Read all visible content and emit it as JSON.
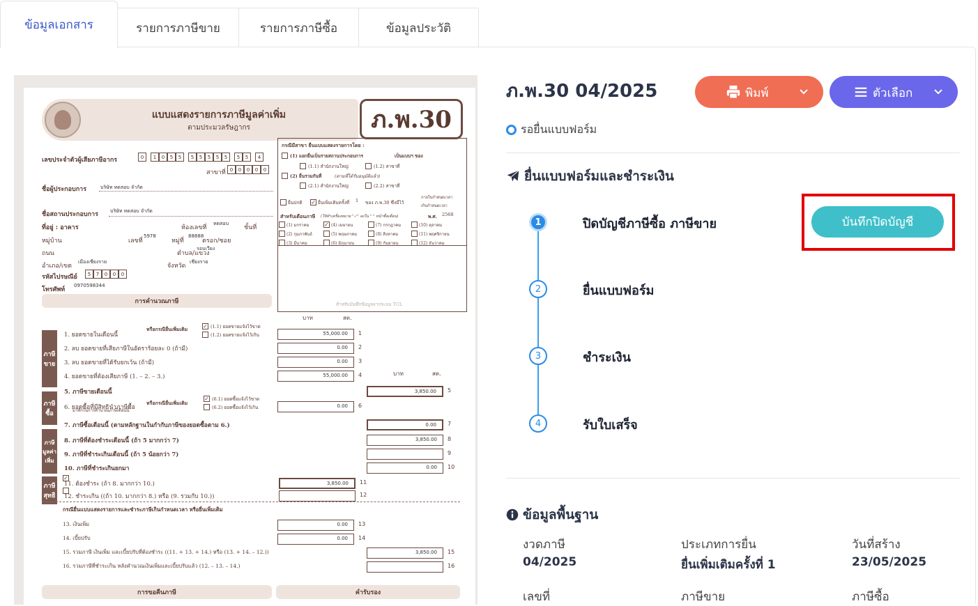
{
  "tabs": [
    {
      "label": "ข้อมูลเอกสาร",
      "active": true
    },
    {
      "label": "รายการภาษีขาย",
      "active": false
    },
    {
      "label": "รายการภาษีซื้อ",
      "active": false
    },
    {
      "label": "ข้อมูลประวัติ",
      "active": false
    }
  ],
  "doc": {
    "title": "แบบแสดงรายการภาษีมูลค่าเพิ่ม",
    "subtitle": "ตามประมวลรัษฎากร",
    "form_code": "ภ.พ.30",
    "taxid_label": "เลขประจำตัวผู้เสียภาษีอากร",
    "taxid_digits": [
      "0",
      "1",
      "0",
      "5",
      "5",
      "5",
      "5",
      "5",
      "5",
      "5",
      "5",
      "5",
      "4"
    ],
    "branch_label": "สาขาที่",
    "branch_digits": [
      "0",
      "0",
      "0",
      "0",
      "0"
    ],
    "operator_label": "ชื่อผู้ประกอบการ",
    "operator_value": "บริษัท ทดสอบ จำกัด",
    "place_label": "ชื่อสถานประกอบการ",
    "place_value": "บริษัท ทดสอบ จำกัด",
    "address_label": "ที่อยู่ : อาคาร",
    "room_label": "ห้องเลขที่",
    "room_value": "ทดสอบ",
    "floor_label": "ชั้นที่",
    "village_label": "หมู่บ้าน",
    "no_label": "เลขที่",
    "no_value": "5978",
    "moo_label": "หมู่ที่",
    "moo_value": "88888",
    "alley_label": "ตรอก/ซอย",
    "road_label": "ถนน",
    "subdistrict_label": "ตำบล/แขวง",
    "subdistrict_value": "รอบเวียง",
    "district_label": "อำเภอ/เขต",
    "district_value": "เมืองเชียงราย",
    "province_label": "จังหวัด",
    "province_value": "เชียงราย",
    "postcode_label": "รหัสไปรษณีย์",
    "postcode_digits": [
      "5",
      "7",
      "0",
      "0",
      "0"
    ],
    "phone_label": "โทรศัพท์",
    "phone_value": "0970598344",
    "calc_bar": "การคำนวณภาษี",
    "branch_case": "กรณีมีสาขา ยื่นแบบแสดงรายการโดย :",
    "opt1": "(1) แยกยื่นเป็นรายสถานประกอบการ",
    "opt1b": "เป็นแบบฯ ของ",
    "opt11": "(1.1) สำนักงานใหญ่",
    "opt12": "(1.2) สาขาที่",
    "opt2": "(2) ยื่นรวมกันที่",
    "opt2note": "(ตามที่ได้รับอนุมัติแล้ว)",
    "opt21": "(2.1) สำนักงานใหญ่",
    "opt22": "(2.2) สาขาที่",
    "normal": "ยื่นปกติ",
    "additional": "ยื่นเพิ่มเติมครั้งที่",
    "additional_no": "1",
    "of_form": "ของ ภ.พ.30 ซึ่งมีไว้",
    "within": "ภายในกำหนดเวลา",
    "beyond": "เกินกำหนดเวลา",
    "month_label": "สำหรับเดือนภาษี",
    "month_note": "(ให้ทำเครื่องหมาย \"✓\" ลงใน \" \" หน้าชื่อเดือน)",
    "year_label": "พ.ศ.",
    "year_value": "2568",
    "months": [
      "(1) มกราคม",
      "(2) กุมภาพันธ์",
      "(3) มีนาคม",
      "(4) เมษายน",
      "(5) พฤษภาคม",
      "(6) มิถุนายน",
      "(7) กรกฎาคม",
      "(8) สิงหาคม",
      "(9) กันยายน",
      "(10) ตุลาคม",
      "(11) พฤศจิกายน",
      "(12) ธันวาคม"
    ],
    "record_note": "สำหรับบันทึกข้อมูลจากระบบ TCL",
    "col_baht": "บาท",
    "col_satang": "สต.",
    "rows": [
      {
        "label": "1. ยอดขายในเดือนนี้",
        "value": "55,000.00",
        "n": "1"
      },
      {
        "label": "2. ลบ ยอดขายที่เสียภาษีในอัตราร้อยละ 0 (ถ้ามี)",
        "value": "0.00",
        "n": "2"
      },
      {
        "label": "3. ลบ ยอดขายที่ได้รับยกเว้น (ถ้ามี)",
        "value": "0.00",
        "n": "3"
      },
      {
        "label": "4. ยอดขายที่ต้องเสียภาษี (1. – 2. – 3.)",
        "value": "55,000.00",
        "n": "4"
      },
      {
        "label": "5. ภาษีขายเดือนนี้",
        "value": "3,850.00",
        "n": "5"
      },
      {
        "label": "6. ยอดซื้อที่มีสิทธินำภาษีซื้อ",
        "value": "0.00",
        "n": "6"
      },
      {
        "label": "7. ภาษีซื้อเดือนนี้ (ตามหลักฐานในกำกับภาษีของยอดซื้อตาม 6.)",
        "value": "0.00",
        "n": "7"
      },
      {
        "label": "8. ภาษีที่ต้องชำระเดือนนี้ (ถ้า 5 มากกว่า 7)",
        "value": "3,850.00",
        "n": "8"
      },
      {
        "label": "9. ภาษีที่ชำระเกินเดือนนี้ (ถ้า 5 น้อยกว่า 7)",
        "value": "",
        "n": "9"
      },
      {
        "label": "10. ภาษีที่ชำระเกินยกมา",
        "value": "0.00",
        "n": "10"
      },
      {
        "label": "11. ต้องชำระ (ถ้า 8. มากกว่า 10.)",
        "value": "3,850.00",
        "n": "11"
      },
      {
        "label": "12. ชำระเกิน ((ถ้า 10. มากกว่า 8.) หรือ (9. รวมกับ 10.))",
        "value": "",
        "n": "12"
      },
      {
        "label": "13. เงินเพิ่ม",
        "value": "0.00",
        "n": "13"
      },
      {
        "label": "14. เบี้ยปรับ",
        "value": "0.00",
        "n": "14"
      },
      {
        "label": "15. รวมภาษี เงินเพิ่ม และเบี้ยปรับที่ต้องชำระ ((11. + 13. + 14.) หรือ (13. + 14. – 12.))",
        "value": "3,850.00",
        "n": "15"
      },
      {
        "label": "16. รวมภาษีที่ชำระเกิน หลังคำนวณเงินเพิ่มและเบี้ยปรับแล้ว (12. – 13. – 14.)",
        "value": "",
        "n": "16"
      }
    ],
    "or_case_1": "หรือกรณียื่นเพิ่มเติม",
    "sub11": "(1.1) ยอดขายแจ้งไว้ขาด",
    "sub12": "(1.2) ยอดขายแจ้งไว้เกิน",
    "sub61": "(6.1) ยอดซื้อแจ้งไว้ขาด",
    "sub62": "(6.2) ยอดซื้อแจ้งไว้เกิน",
    "note6": "มาหักในการคำนวณภาษีเดือนนี้",
    "late_case": "กรณียื่นแบบแสดงรายการและชำระภาษีเกินกำหนดเวลา หรือยื่นเพิ่มเติม",
    "side_sales": "ภาษีขาย",
    "side_purchase": "ภาษีซื้อ",
    "side_vat": "ภาษีมูลค่าเพิ่ม",
    "side_net": "ภาษีสุทธิ",
    "refund_bar": "การขอคืนภาษี",
    "certify_bar": "คำรับรอง"
  },
  "right": {
    "title": "ภ.พ.30 04/2025",
    "print_label": "พิมพ์",
    "options_label": "ตัวเลือก",
    "status_text": "รอยื่นแบบฟอร์ม",
    "status_color": "#2b8be6",
    "section_submit": "ยื่นแบบฟอร์มและชำระเงิน",
    "steps": [
      {
        "n": "1",
        "label": "ปิดบัญชีภาษีซื้อ ภาษีขาย",
        "active": true
      },
      {
        "n": "2",
        "label": "ยื่นแบบฟอร์ม",
        "active": false
      },
      {
        "n": "3",
        "label": "ชำระเงิน",
        "active": false
      },
      {
        "n": "4",
        "label": "รับใบเสร็จ",
        "active": false
      }
    ],
    "close_button": "บันทึกปิดบัญชี",
    "section_basic": "ข้อมูลพื้นฐาน",
    "fields": [
      {
        "label": "งวดภาษี",
        "value": "04/2025"
      },
      {
        "label": "ประเภทการยื่น",
        "value": "ยื่นเพิ่มเติมครั้งที่ 1"
      },
      {
        "label": "วันที่สร้าง",
        "value": "23/05/2025"
      },
      {
        "label": "เลขที่",
        "value": ""
      },
      {
        "label": "ภาษีขาย",
        "value": ""
      },
      {
        "label": "ภาษีซื้อ",
        "value": ""
      }
    ],
    "colors": {
      "print": "#f06e54",
      "options": "#6a67ea",
      "close": "#3fbfc9",
      "highlight": "#e00000",
      "step": "#2b8be6"
    }
  }
}
